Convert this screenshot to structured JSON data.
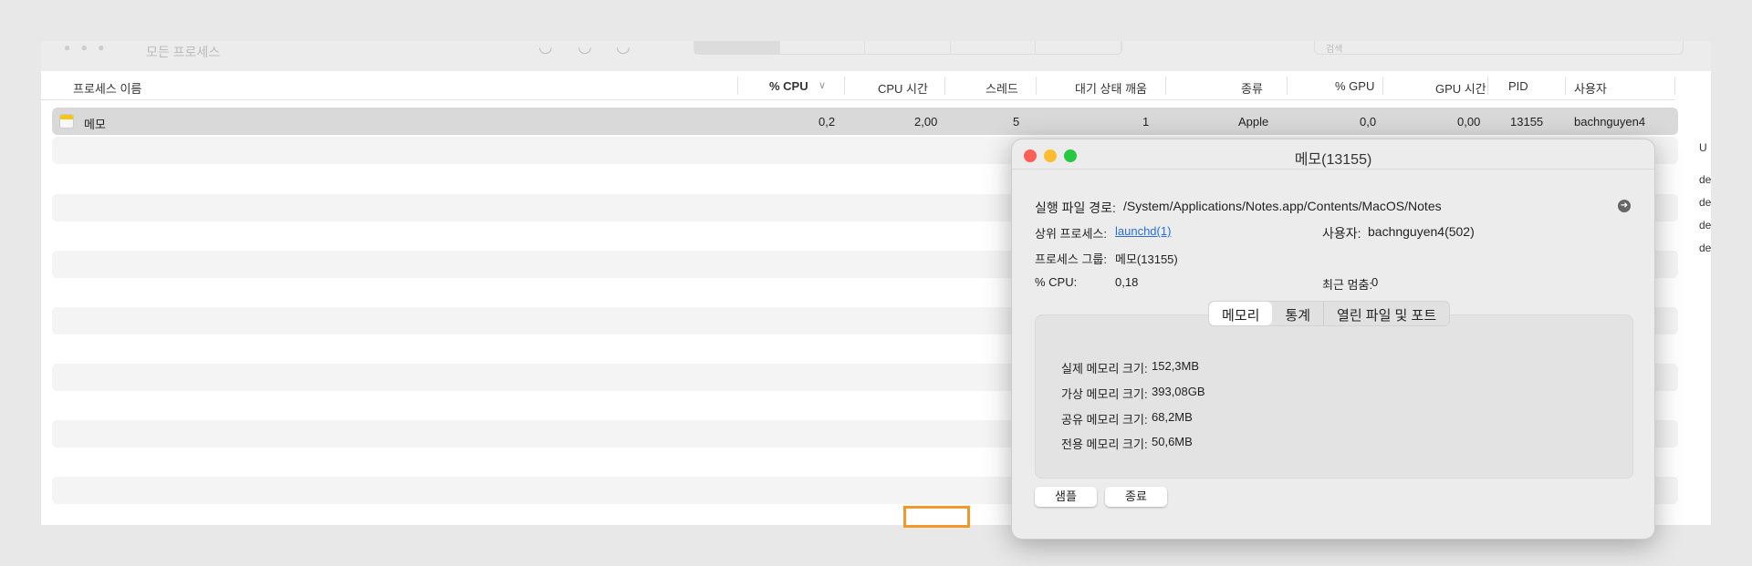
{
  "toolbar": {
    "title": "모든 프로세스",
    "search_placeholder": "검색"
  },
  "columns": [
    "프로세스 이름",
    "% CPU",
    "CPU 시간",
    "스레드",
    "대기 상태 깨움",
    "종류",
    "% GPU",
    "GPU 시간",
    "PID",
    "사용자"
  ],
  "sort_indicator": "chevron-down-icon",
  "rows": [
    {
      "name": "메모",
      "cpu": "0,2",
      "cpu_time": "2,00",
      "threads": "5",
      "wakeups": "1",
      "kind": "Apple",
      "gpu": "0,0",
      "gpu_time": "0,00",
      "pid": "13155",
      "user": "bachnguyen4",
      "selected": true
    }
  ],
  "side_column": [
    "U",
    "de",
    "de",
    "de",
    "de"
  ],
  "dialog": {
    "title": "메모(13155)",
    "path_label": "실행 파일 경로:",
    "path": "/System/Applications/Notes.app/Contents/MacOS/Notes",
    "parent_label": "상위 프로세스:",
    "parent": "launchd(1)",
    "user_label": "사용자:",
    "user": "bachnguyen4(502)",
    "group_label": "프로세스 그룹:",
    "group": "메모(13155)",
    "cpu_label": "% CPU:",
    "cpu": "0,18",
    "hangs_label": "최근 멈춤:",
    "hangs": "0",
    "tabs": [
      "메모리",
      "통계",
      "열린 파일 및 포트"
    ],
    "active_tab": "메모리",
    "memory": [
      {
        "label": "실제 메모리 크기:",
        "value": "152,3MB"
      },
      {
        "label": "가상 메모리 크기:",
        "value": "393,08GB"
      },
      {
        "label": "공유 메모리 크기:",
        "value": "68,2MB"
      },
      {
        "label": "전용 메모리 크기:",
        "value": "50,6MB"
      }
    ],
    "sample_button": "샘플",
    "quit_button": "종료"
  },
  "colors": {
    "close": "#fe5f57",
    "minimize": "#febc2e",
    "zoom": "#28c840",
    "link": "#2a6fd6",
    "highlight": "#f0982a"
  }
}
